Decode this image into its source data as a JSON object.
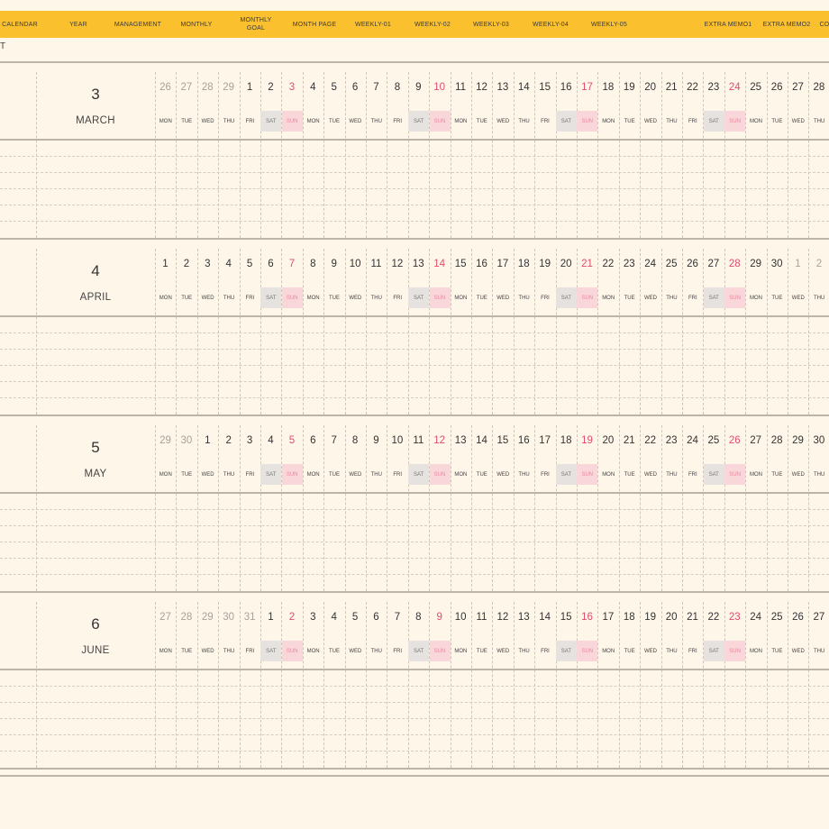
{
  "nav": {
    "tabs": [
      "CALENDAR",
      "YEAR",
      "MANAGEMENT",
      "MONTHLY",
      "MONTHLY\nGOAL",
      "MONTH PAGE",
      "WEEKLY-01",
      "WEEKLY-02",
      "WEEKLY-03",
      "WEEKLY-04",
      "WEEKLY-05",
      "EXTRA MEMO1",
      "EXTRA MEMO2",
      "CO"
    ]
  },
  "subheader_label": "T",
  "months": [
    {
      "number": "3",
      "name": "MARCH",
      "days": [
        "26",
        "27",
        "28",
        "29",
        "1",
        "2",
        "3",
        "4",
        "5",
        "6",
        "7",
        "8",
        "9",
        "10",
        "11",
        "12",
        "13",
        "14",
        "15",
        "16",
        "17",
        "18",
        "19",
        "20",
        "21",
        "22",
        "23",
        "24",
        "25",
        "26",
        "27",
        "28"
      ],
      "muted": [
        true,
        true,
        true,
        true,
        false,
        false,
        false,
        false,
        false,
        false,
        false,
        false,
        false,
        false,
        false,
        false,
        false,
        false,
        false,
        false,
        false,
        false,
        false,
        false,
        false,
        false,
        false,
        false,
        false,
        false,
        false,
        false
      ]
    },
    {
      "number": "4",
      "name": "APRIL",
      "days": [
        "1",
        "2",
        "3",
        "4",
        "5",
        "6",
        "7",
        "8",
        "9",
        "10",
        "11",
        "12",
        "13",
        "14",
        "15",
        "16",
        "17",
        "18",
        "19",
        "20",
        "21",
        "22",
        "23",
        "24",
        "25",
        "26",
        "27",
        "28",
        "29",
        "30",
        "1",
        "2"
      ],
      "muted": [
        false,
        false,
        false,
        false,
        false,
        false,
        false,
        false,
        false,
        false,
        false,
        false,
        false,
        false,
        false,
        false,
        false,
        false,
        false,
        false,
        false,
        false,
        false,
        false,
        false,
        false,
        false,
        false,
        false,
        false,
        true,
        true
      ]
    },
    {
      "number": "5",
      "name": "MAY",
      "days": [
        "29",
        "30",
        "1",
        "2",
        "3",
        "4",
        "5",
        "6",
        "7",
        "8",
        "9",
        "10",
        "11",
        "12",
        "13",
        "14",
        "15",
        "16",
        "17",
        "18",
        "19",
        "20",
        "21",
        "22",
        "23",
        "24",
        "25",
        "26",
        "27",
        "28",
        "29",
        "30"
      ],
      "muted": [
        true,
        true,
        false,
        false,
        false,
        false,
        false,
        false,
        false,
        false,
        false,
        false,
        false,
        false,
        false,
        false,
        false,
        false,
        false,
        false,
        false,
        false,
        false,
        false,
        false,
        false,
        false,
        false,
        false,
        false,
        false,
        false
      ]
    },
    {
      "number": "6",
      "name": "JUNE",
      "days": [
        "27",
        "28",
        "29",
        "30",
        "31",
        "1",
        "2",
        "3",
        "4",
        "5",
        "6",
        "7",
        "8",
        "9",
        "10",
        "11",
        "12",
        "13",
        "14",
        "15",
        "16",
        "17",
        "18",
        "19",
        "20",
        "21",
        "22",
        "23",
        "24",
        "25",
        "26",
        "27"
      ],
      "muted": [
        true,
        true,
        true,
        true,
        true,
        false,
        false,
        false,
        false,
        false,
        false,
        false,
        false,
        false,
        false,
        false,
        false,
        false,
        false,
        false,
        false,
        false,
        false,
        false,
        false,
        false,
        false,
        false,
        false,
        false,
        false,
        false
      ]
    }
  ],
  "weekdays": [
    "MON",
    "TUE",
    "WED",
    "THU",
    "FRI",
    "SAT",
    "SUN"
  ],
  "colors": {
    "nav_bar": "#fbc02d",
    "background": "#fef6e9",
    "sunday_text": "#e04d6b",
    "sunday_fill": "#f9d6da",
    "saturday_fill": "#e5e2df"
  }
}
